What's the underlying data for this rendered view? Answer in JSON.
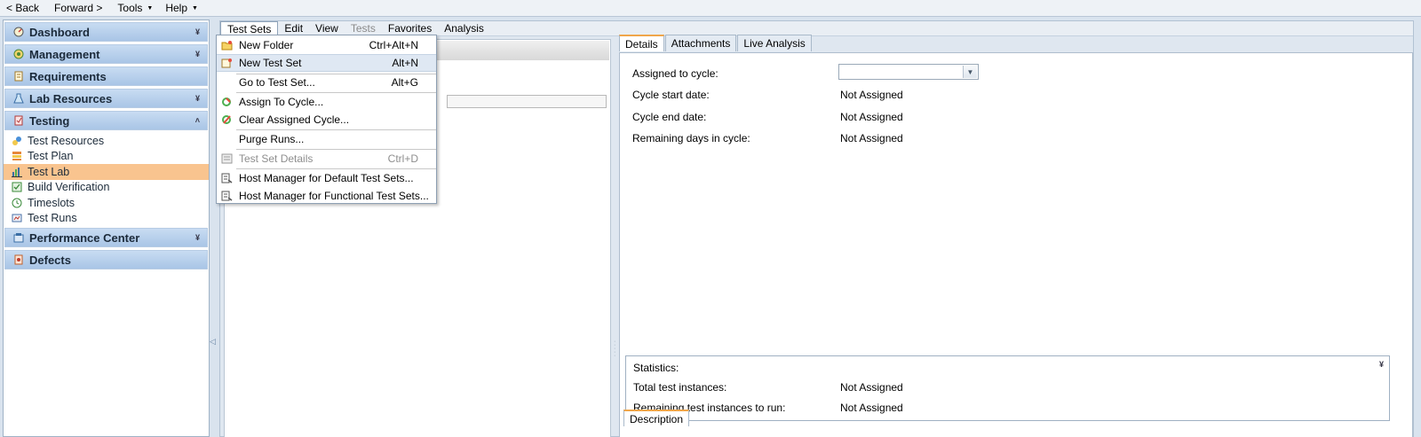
{
  "topbar": {
    "back": "< Back",
    "forward": "Forward >",
    "tools": "Tools",
    "help": "Help"
  },
  "sidebar": {
    "groups": {
      "dashboard": "Dashboard",
      "management": "Management",
      "requirements": "Requirements",
      "lab_resources": "Lab Resources",
      "testing": "Testing",
      "performance_center": "Performance Center",
      "defects": "Defects"
    },
    "testing_items": [
      {
        "label": "Test Resources",
        "icon": "test-resources-icon"
      },
      {
        "label": "Test Plan",
        "icon": "test-plan-icon"
      },
      {
        "label": "Test Lab",
        "icon": "test-lab-icon",
        "active": true
      },
      {
        "label": "Build Verification",
        "icon": "build-verification-icon"
      },
      {
        "label": "Timeslots",
        "icon": "timeslots-icon"
      },
      {
        "label": "Test Runs",
        "icon": "test-runs-icon"
      }
    ],
    "active_color": "#f9c48f"
  },
  "menubar": {
    "items": [
      "Test Sets",
      "Edit",
      "View",
      "Tests",
      "Favorites",
      "Analysis"
    ],
    "disabled": [
      "Tests"
    ],
    "open": "Test Sets"
  },
  "dropdown": {
    "items": [
      {
        "label": "New Folder",
        "shortcut": "Ctrl+Alt+N",
        "icon": "new-folder-icon"
      },
      {
        "label": "New Test Set",
        "shortcut": "Alt+N",
        "icon": "new-test-set-icon",
        "highlighted": true
      },
      {
        "label": "Go to Test Set...",
        "shortcut": "Alt+G",
        "icon": ""
      },
      {
        "label": "Assign To Cycle...",
        "shortcut": "",
        "icon": "assign-cycle-icon"
      },
      {
        "label": "Clear Assigned Cycle...",
        "shortcut": "",
        "icon": "clear-cycle-icon"
      },
      {
        "label": "Purge Runs...",
        "shortcut": "",
        "icon": ""
      },
      {
        "label": "Test Set Details",
        "shortcut": "Ctrl+D",
        "icon": "test-set-details-icon",
        "disabled": true
      },
      {
        "label": "Host Manager for Default Test Sets...",
        "shortcut": "",
        "icon": "host-manager-icon"
      },
      {
        "label": "Host Manager for Functional Test Sets...",
        "shortcut": "",
        "icon": "host-manager-icon"
      }
    ]
  },
  "details": {
    "tabs": [
      "Details",
      "Attachments",
      "Live Analysis"
    ],
    "active_tab": "Details",
    "fields": [
      {
        "label": "Assigned to cycle:",
        "value": ""
      },
      {
        "label": "Cycle start date:",
        "value": "Not Assigned"
      },
      {
        "label": "Cycle end date:",
        "value": "Not Assigned"
      },
      {
        "label": "Remaining days in cycle:",
        "value": "Not Assigned"
      }
    ],
    "statistics": {
      "title": "Statistics:",
      "rows": [
        {
          "label": "Total test instances:",
          "value": "Not Assigned"
        },
        {
          "label": "Remaining test instances to run:",
          "value": "Not Assigned"
        }
      ]
    },
    "description_tab": "Description"
  }
}
